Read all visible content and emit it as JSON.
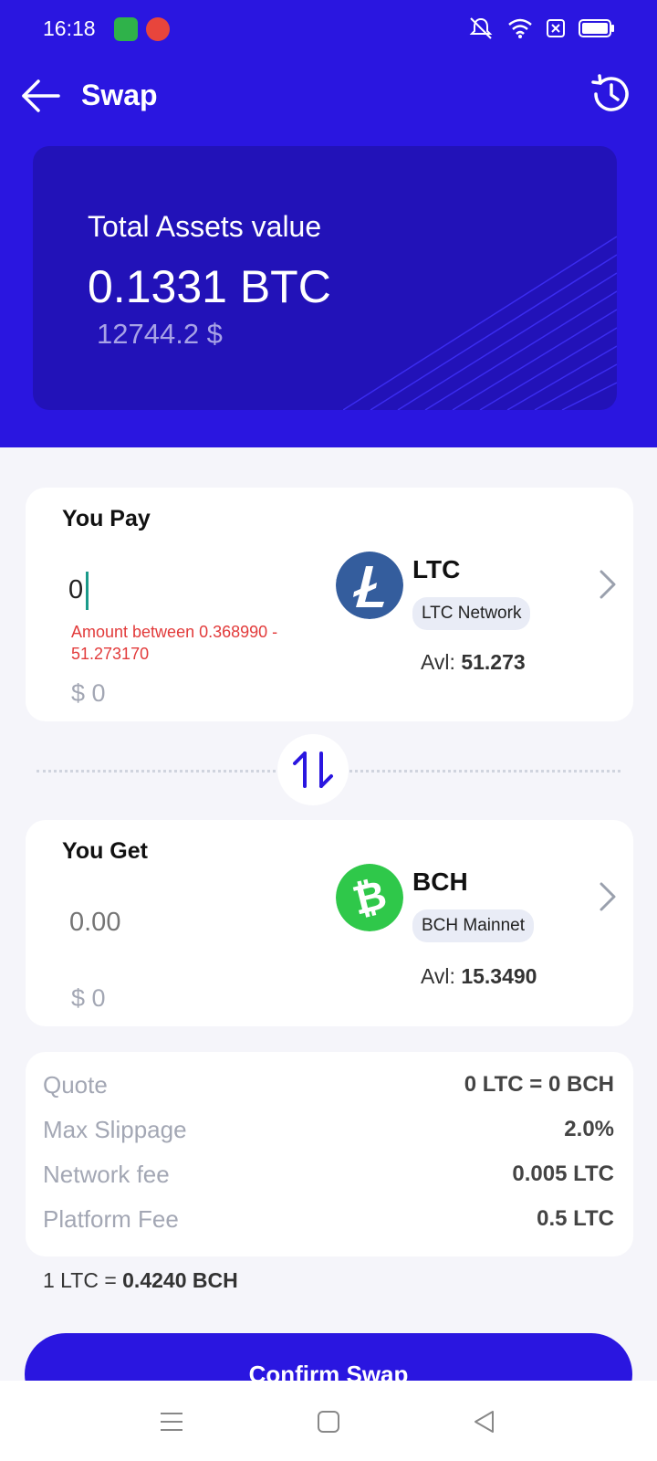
{
  "status_bar": {
    "time": "16:18"
  },
  "header": {
    "title": "Swap",
    "back_icon": "arrow-left-icon",
    "history_icon": "history-icon"
  },
  "assets": {
    "label": "Total Assets value",
    "btc_value": "0.1331 BTC",
    "usd_value": "12744.2 $"
  },
  "pay": {
    "title": "You Pay",
    "amount": "0",
    "error": "Amount between 0.368990 - 51.273170",
    "fiat": "$ 0",
    "coin_symbol": "LTC",
    "network": "LTC Network",
    "avl_label": "Avl:",
    "avl_value": "51.273",
    "coin_color": "#345d9d"
  },
  "get": {
    "title": "You Get",
    "amount_placeholder": "0.00",
    "fiat": "$ 0",
    "coin_symbol": "BCH",
    "network": "BCH Mainnet",
    "avl_label": "Avl:",
    "avl_value": "15.3490",
    "coin_color": "#2fc84a"
  },
  "details": {
    "rows": [
      {
        "label": "Quote",
        "value": "0 LTC = 0 BCH"
      },
      {
        "label": "Max Slippage",
        "value": "2.0%"
      },
      {
        "label": "Network fee",
        "value": "0.005 LTC"
      },
      {
        "label": "Platform Fee",
        "value": "0.5 LTC"
      }
    ]
  },
  "rate": {
    "left": "1 LTC = ",
    "right": "0.4240 BCH"
  },
  "confirm_label": "Confirm Swap",
  "colors": {
    "primary": "#2a16e0",
    "card_dark": "#2212b8",
    "error": "#e23b3b"
  }
}
